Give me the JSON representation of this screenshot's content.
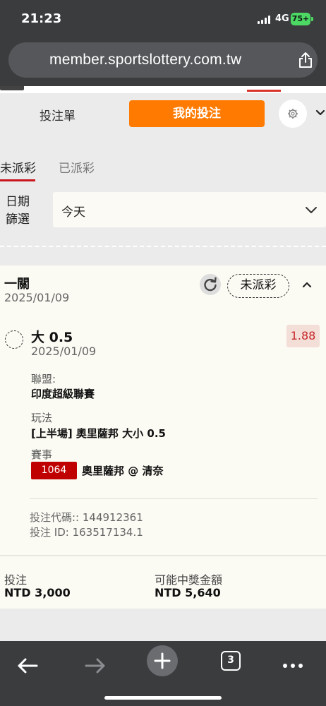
{
  "status": {
    "time": "21:23",
    "network": "4G",
    "battery": "75+"
  },
  "browser": {
    "url": "member.sportslottery.com.tw",
    "tab_count": "3"
  },
  "header": {
    "tab_bet_slip": "投注單",
    "tab_my_bets": "我的投注"
  },
  "subtabs": {
    "unpaid": "未派彩",
    "paid": "已派彩"
  },
  "filter": {
    "label_line1": "日期",
    "label_line2": "篩選",
    "selected": "今天"
  },
  "bet": {
    "type": "一關",
    "date": "2025/01/09",
    "status": "未派彩",
    "selection": "大 0.5",
    "selection_date": "2025/01/09",
    "odds": "1.88",
    "league_label": "聯盟:",
    "league": "印度超級聯賽",
    "market_label": "玩法",
    "market": "[上半場] 奧里薩邦 大小 0.5",
    "event_label": "賽事",
    "event_id": "1064",
    "event_name": "奧里薩邦 @ 清奈",
    "code_line": "投注代碼:: 144912361",
    "id_line": "投注 ID: 163517134.1",
    "stake_label": "投注",
    "stake": "NTD 3,000",
    "payout_label": "可能中獎金額",
    "payout": "NTD 5,640"
  },
  "icons": {
    "share": "share-icon",
    "settings": "gear-icon",
    "chevron": "chevron-down-icon",
    "refresh": "refresh-icon",
    "back": "back-arrow-icon",
    "forward": "forward-arrow-icon",
    "new_tab": "plus-icon",
    "more": "more-dots-icon"
  },
  "colors": {
    "accent": "#ff7a00",
    "active_underline": "#c8161d",
    "event_badge": "#c00000",
    "odds_text": "#c62828"
  }
}
